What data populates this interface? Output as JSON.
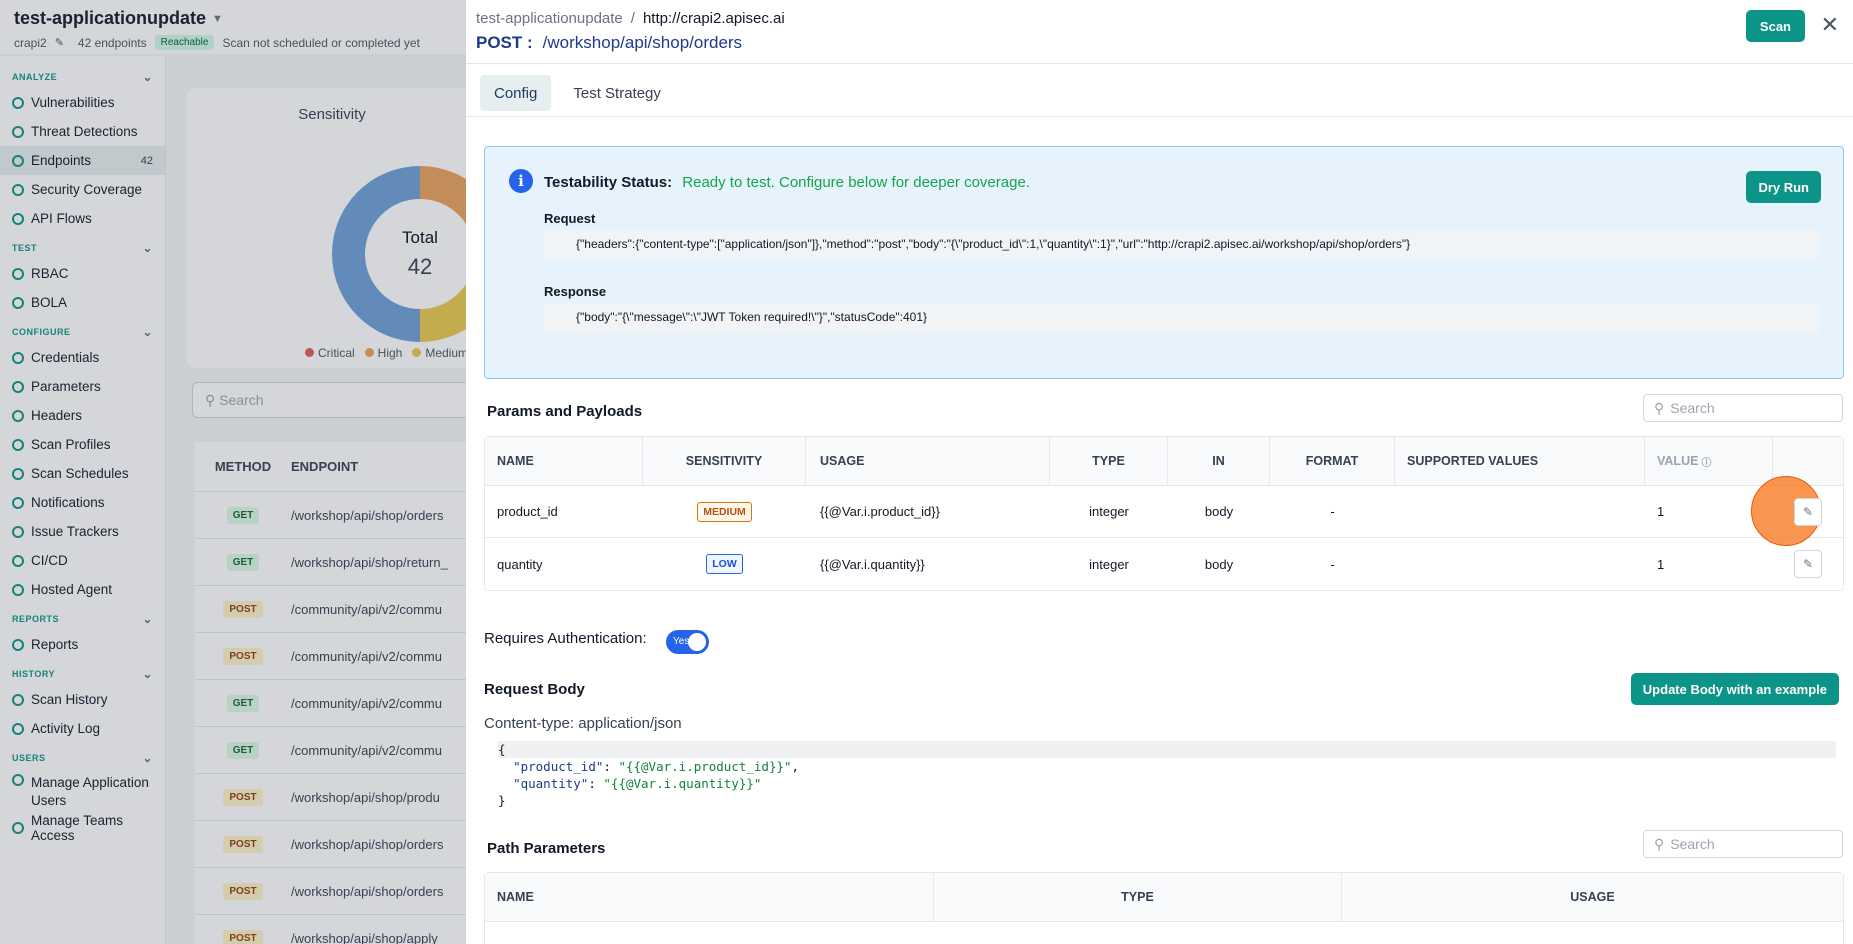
{
  "header": {
    "app_name": "test-applicationupdate",
    "project": "crapi2",
    "endpoints_count": "42 endpoints",
    "reachable": "Reachable",
    "scan_status": "Scan not scheduled or completed yet"
  },
  "sidebar": {
    "sections": [
      {
        "title": "ANALYZE",
        "items": [
          {
            "label": "Vulnerabilities",
            "icon": "shield-icon"
          },
          {
            "label": "Threat Detections",
            "icon": "radar-icon"
          },
          {
            "label": "Endpoints",
            "icon": "list-icon",
            "count": "42",
            "active": true
          },
          {
            "label": "Security Coverage",
            "icon": "coverage-icon"
          },
          {
            "label": "API Flows",
            "icon": "flow-icon"
          }
        ]
      },
      {
        "title": "TEST",
        "items": [
          {
            "label": "RBAC",
            "icon": "user-icon"
          },
          {
            "label": "BOLA",
            "icon": "shield-icon"
          }
        ]
      },
      {
        "title": "CONFIGURE",
        "items": [
          {
            "label": "Credentials",
            "icon": "key-icon"
          },
          {
            "label": "Parameters",
            "icon": "braces-icon"
          },
          {
            "label": "Headers",
            "icon": "header-icon"
          },
          {
            "label": "Scan Profiles",
            "icon": "profile-icon"
          },
          {
            "label": "Scan Schedules",
            "icon": "calendar-icon"
          },
          {
            "label": "Notifications",
            "icon": "bell-icon"
          },
          {
            "label": "Issue Trackers",
            "icon": "tracker-icon"
          },
          {
            "label": "CI/CD",
            "icon": "cicd-icon"
          },
          {
            "label": "Hosted Agent",
            "icon": "agent-icon"
          }
        ]
      },
      {
        "title": "REPORTS",
        "items": [
          {
            "label": "Reports",
            "icon": "report-icon"
          }
        ]
      },
      {
        "title": "HISTORY",
        "items": [
          {
            "label": "Scan History",
            "icon": "history-icon"
          },
          {
            "label": "Activity Log",
            "icon": "log-icon"
          }
        ]
      },
      {
        "title": "USERS",
        "items": [
          {
            "label": "Manage Application Users",
            "icon": "users-icon"
          },
          {
            "label": "Manage Teams Access",
            "icon": "team-icon"
          }
        ]
      }
    ]
  },
  "background": {
    "chart_title": "Sensitivity",
    "total_label": "Total",
    "total_value": "42",
    "legend": [
      {
        "label": "Critical",
        "color": "#e05a5a"
      },
      {
        "label": "High",
        "color": "#e8a25a"
      },
      {
        "label": "Medium",
        "color": "#e9c94e"
      }
    ],
    "search_placeholder": "Search",
    "columns": [
      "METHOD",
      "ENDPOINT"
    ],
    "rows": [
      {
        "method": "GET",
        "endpoint": "/workshop/api/shop/orders"
      },
      {
        "method": "GET",
        "endpoint": "/workshop/api/shop/return_"
      },
      {
        "method": "POST",
        "endpoint": "/community/api/v2/commu"
      },
      {
        "method": "POST",
        "endpoint": "/community/api/v2/commu"
      },
      {
        "method": "GET",
        "endpoint": "/community/api/v2/commu"
      },
      {
        "method": "GET",
        "endpoint": "/community/api/v2/commu"
      },
      {
        "method": "POST",
        "endpoint": "/workshop/api/shop/produ"
      },
      {
        "method": "POST",
        "endpoint": "/workshop/api/shop/orders"
      },
      {
        "method": "POST",
        "endpoint": "/workshop/api/shop/orders"
      },
      {
        "method": "POST",
        "endpoint": "/workshop/api/shop/apply_"
      }
    ]
  },
  "drawer": {
    "breadcrumb_app": "test-applicationupdate",
    "breadcrumb_sep": "/",
    "breadcrumb_url": "http://crapi2.apisec.ai",
    "method": "POST :",
    "path": "/workshop/api/shop/orders",
    "scan_label": "Scan",
    "close": "✕",
    "tabs": [
      "Config",
      "Test Strategy"
    ],
    "testability": {
      "label": "Testability Status:",
      "value": "Ready to test. Configure below for deeper coverage.",
      "dry_run": "Dry Run",
      "request_label": "Request",
      "request": "{\"headers\":{\"content-type\":[\"application/json\"]},\"method\":\"post\",\"body\":\"{\\\"product_id\\\":1,\\\"quantity\\\":1}\",\"url\":\"http://crapi2.apisec.ai/workshop/api/shop/orders\"}",
      "response_label": "Response",
      "response": "{\"body\":\"{\\\"message\\\":\\\"JWT Token required!\\\"}\",\"statusCode\":401}"
    },
    "params": {
      "title": "Params and Payloads",
      "search_placeholder": "Search",
      "columns": [
        "NAME",
        "SENSITIVITY",
        "USAGE",
        "TYPE",
        "IN",
        "FORMAT",
        "SUPPORTED VALUES",
        "VALUE",
        ""
      ],
      "rows": [
        {
          "name": "product_id",
          "sensitivity": "MEDIUM",
          "usage": "{{@Var.i.product_id}}",
          "type": "integer",
          "in": "body",
          "format": "-",
          "supported": "",
          "value": "1"
        },
        {
          "name": "quantity",
          "sensitivity": "LOW",
          "usage": "{{@Var.i.quantity}}",
          "type": "integer",
          "in": "body",
          "format": "-",
          "supported": "",
          "value": "1"
        }
      ]
    },
    "auth": {
      "label": "Requires Authentication:",
      "toggle": "Yes"
    },
    "request_body": {
      "title": "Request Body",
      "update_label": "Update Body with an example",
      "content_type": "Content-type: application/json",
      "lines": [
        "{",
        "  \"product_id\": \"{{@Var.i.product_id}}\",",
        "  \"quantity\": \"{{@Var.i.quantity}}\"",
        "}"
      ]
    },
    "path_params": {
      "title": "Path Parameters",
      "search_placeholder": "Search",
      "columns": [
        "NAME",
        "TYPE",
        "USAGE"
      ]
    }
  },
  "colors": {
    "accent": "#0d9488",
    "primary_blue": "#2563eb",
    "status_green": "#16a34a"
  }
}
